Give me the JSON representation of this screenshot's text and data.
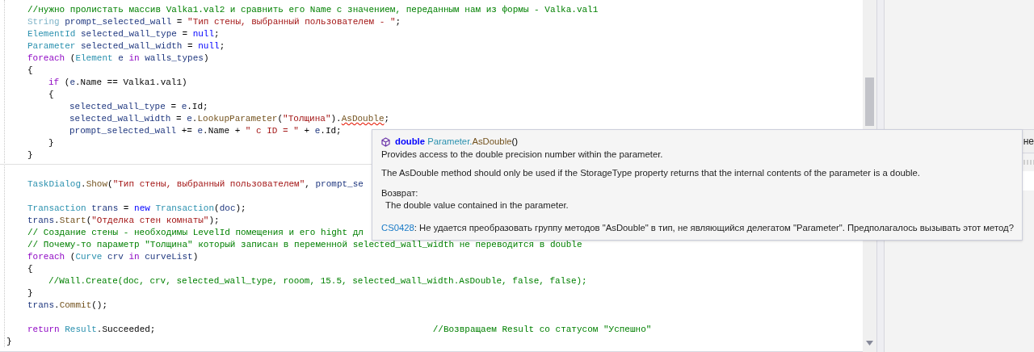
{
  "editor": {
    "lines": [
      {
        "kind": "block",
        "children": [
          {
            "kind": "code",
            "tokens": [
              {
                "kind": "comment",
                "text": "//нужно пролистать массив Valka1.val2 и сравнить его Name с значением, переданным нам из формы - Valka.val1"
              }
            ]
          },
          {
            "kind": "code",
            "tokens": [
              {
                "kind": "type_faded",
                "text": "String"
              },
              {
                "kind": "variable",
                "text": " prompt_selected_wall"
              },
              {
                "kind": "plain",
                "text": " = "
              },
              {
                "kind": "string",
                "text": "\"Тип стены, выбранный пользователем - \""
              },
              {
                "kind": "plain",
                "text": ";"
              }
            ]
          },
          {
            "kind": "code",
            "tokens": [
              {
                "kind": "type",
                "text": "ElementId"
              },
              {
                "kind": "variable",
                "text": " selected_wall_type"
              },
              {
                "kind": "plain",
                "text": " = "
              },
              {
                "kind": "keyword",
                "text": "null"
              },
              {
                "kind": "plain",
                "text": ";"
              }
            ]
          },
          {
            "kind": "code",
            "tokens": [
              {
                "kind": "type",
                "text": "Parameter"
              },
              {
                "kind": "variable",
                "text": " selected_wall_width"
              },
              {
                "kind": "plain",
                "text": " = "
              },
              {
                "kind": "keyword",
                "text": "null"
              },
              {
                "kind": "plain",
                "text": ";"
              }
            ]
          },
          {
            "kind": "code",
            "tokens": [
              {
                "kind": "control",
                "text": "foreach"
              },
              {
                "kind": "plain",
                "text": " ("
              },
              {
                "kind": "type",
                "text": "Element"
              },
              {
                "kind": "variable",
                "text": " e"
              },
              {
                "kind": "control",
                "text": " in"
              },
              {
                "kind": "variable",
                "text": " walls_types"
              },
              {
                "kind": "plain",
                "text": ")"
              }
            ]
          },
          {
            "kind": "code",
            "tokens": [
              {
                "kind": "plain",
                "text": "{"
              }
            ]
          },
          {
            "kind": "block",
            "children": [
              {
                "kind": "code",
                "tokens": [
                  {
                    "kind": "control",
                    "text": "if"
                  },
                  {
                    "kind": "plain",
                    "text": " ("
                  },
                  {
                    "kind": "variable",
                    "text": "e"
                  },
                  {
                    "kind": "plain",
                    "text": ".Name == Valka1.val1)"
                  }
                ]
              },
              {
                "kind": "code",
                "tokens": [
                  {
                    "kind": "plain",
                    "text": "{"
                  }
                ]
              },
              {
                "kind": "block",
                "children": [
                  {
                    "kind": "code",
                    "tokens": [
                      {
                        "kind": "variable",
                        "text": "selected_wall_type"
                      },
                      {
                        "kind": "plain",
                        "text": " = "
                      },
                      {
                        "kind": "variable",
                        "text": "e"
                      },
                      {
                        "kind": "plain",
                        "text": ".Id;"
                      }
                    ]
                  },
                  {
                    "kind": "code",
                    "tokens": [
                      {
                        "kind": "variable",
                        "text": "selected_wall_width"
                      },
                      {
                        "kind": "plain",
                        "text": " = "
                      },
                      {
                        "kind": "variable",
                        "text": "e"
                      },
                      {
                        "kind": "plain",
                        "text": "."
                      },
                      {
                        "kind": "method",
                        "text": "LookupParameter"
                      },
                      {
                        "kind": "plain",
                        "text": "("
                      },
                      {
                        "kind": "string",
                        "text": "\"Толщина\""
                      },
                      {
                        "kind": "plain",
                        "text": ")."
                      },
                      {
                        "kind": "error",
                        "text": "AsDouble"
                      },
                      {
                        "kind": "plain",
                        "text": ";"
                      }
                    ]
                  },
                  {
                    "kind": "code",
                    "tokens": [
                      {
                        "kind": "variable",
                        "text": "prompt_selected_wall"
                      },
                      {
                        "kind": "plain",
                        "text": " += "
                      },
                      {
                        "kind": "variable",
                        "text": "e"
                      },
                      {
                        "kind": "plain",
                        "text": ".Name + "
                      },
                      {
                        "kind": "string",
                        "text": "\" с ID = \""
                      },
                      {
                        "kind": "plain",
                        "text": " + "
                      },
                      {
                        "kind": "variable",
                        "text": "e"
                      },
                      {
                        "kind": "plain",
                        "text": ".Id;"
                      }
                    ]
                  }
                ]
              },
              {
                "kind": "code",
                "tokens": [
                  {
                    "kind": "plain",
                    "text": "}"
                  }
                ]
              }
            ]
          },
          {
            "kind": "code",
            "tokens": [
              {
                "kind": "plain",
                "text": "}"
              }
            ]
          }
        ]
      },
      {
        "kind": "rule"
      },
      {
        "kind": "block",
        "children": [
          {
            "kind": "blank"
          },
          {
            "kind": "code",
            "tokens": [
              {
                "kind": "type",
                "text": "TaskDialog"
              },
              {
                "kind": "plain",
                "text": "."
              },
              {
                "kind": "method",
                "text": "Show"
              },
              {
                "kind": "plain",
                "text": "("
              },
              {
                "kind": "string",
                "text": "\"Тип стены, выбранный пользователем\""
              },
              {
                "kind": "plain",
                "text": ", "
              },
              {
                "kind": "variable",
                "text": "prompt_se"
              }
            ]
          },
          {
            "kind": "blank"
          },
          {
            "kind": "code",
            "tokens": [
              {
                "kind": "type",
                "text": "Transaction"
              },
              {
                "kind": "variable",
                "text": " trans"
              },
              {
                "kind": "plain",
                "text": " = "
              },
              {
                "kind": "keyword",
                "text": "new"
              },
              {
                "kind": "type",
                "text": " Transaction"
              },
              {
                "kind": "plain",
                "text": "("
              },
              {
                "kind": "variable",
                "text": "doc"
              },
              {
                "kind": "plain",
                "text": ");"
              }
            ]
          },
          {
            "kind": "code",
            "tokens": [
              {
                "kind": "variable",
                "text": "trans"
              },
              {
                "kind": "plain",
                "text": "."
              },
              {
                "kind": "method",
                "text": "Start"
              },
              {
                "kind": "plain",
                "text": "("
              },
              {
                "kind": "string",
                "text": "\"Отделка стен комнаты\""
              },
              {
                "kind": "plain",
                "text": ");"
              }
            ]
          },
          {
            "kind": "code",
            "tokens": [
              {
                "kind": "comment",
                "text": "// Создание стены - необходимы LevelId помещения и его hight дл"
              }
            ]
          },
          {
            "kind": "code",
            "tokens": [
              {
                "kind": "comment",
                "text": "// Почему-то параметр \"Толщина\" который записан в переменной selected_wall_width не переводится в double"
              }
            ]
          },
          {
            "kind": "code",
            "tokens": [
              {
                "kind": "control",
                "text": "foreach"
              },
              {
                "kind": "plain",
                "text": " ("
              },
              {
                "kind": "type",
                "text": "Curve"
              },
              {
                "kind": "variable",
                "text": " crv"
              },
              {
                "kind": "control",
                "text": " in"
              },
              {
                "kind": "variable",
                "text": " curveList"
              },
              {
                "kind": "plain",
                "text": ")"
              }
            ]
          },
          {
            "kind": "code",
            "tokens": [
              {
                "kind": "plain",
                "text": "{"
              }
            ]
          },
          {
            "kind": "block",
            "children": [
              {
                "kind": "code",
                "tokens": [
                  {
                    "kind": "comment",
                    "text": "//Wall.Create(doc, crv, selected_wall_type, rooom, 15.5, selected_wall_width.AsDouble, false, false);"
                  }
                ]
              }
            ]
          },
          {
            "kind": "code",
            "tokens": [
              {
                "kind": "plain",
                "text": "}"
              }
            ]
          },
          {
            "kind": "code",
            "tokens": [
              {
                "kind": "variable",
                "text": "trans"
              },
              {
                "kind": "plain",
                "text": "."
              },
              {
                "kind": "method",
                "text": "Commit"
              },
              {
                "kind": "plain",
                "text": "();"
              }
            ]
          },
          {
            "kind": "blank"
          },
          {
            "kind": "code",
            "tokens": [
              {
                "kind": "control",
                "text": "return"
              },
              {
                "kind": "type",
                "text": " Result"
              },
              {
                "kind": "plain",
                "text": ".Succeeded;"
              },
              {
                "kind": "comment",
                "text": "                                                    //Возвращаем Result со статусом \"Успешно\""
              }
            ]
          }
        ]
      },
      {
        "kind": "code",
        "tokens": [
          {
            "kind": "plain",
            "text": "}"
          }
        ]
      }
    ]
  },
  "tooltip": {
    "signature": [
      {
        "kind": "keyword",
        "text": "double"
      },
      {
        "kind": "type",
        "text": " Parameter."
      },
      {
        "kind": "method",
        "text": "AsDouble"
      },
      {
        "kind": "plain",
        "text": "()"
      }
    ],
    "summary": "Provides access to the double precision number within the parameter.",
    "remarks": "The AsDouble method should only be used if the StorageType property returns that the internal contents of the parameter is a double.",
    "returns_label": "Возврат:",
    "returns": "The double value contained in the parameter.",
    "error_code": "CS0428",
    "error_message": ": Не удается преобразовать группу методов \"AsDouble\" в тип, не являющийся делегатом \"Parameter\". Предполагалось вызывать этот метод?"
  },
  "right_panel": {
    "row_text": "не"
  }
}
